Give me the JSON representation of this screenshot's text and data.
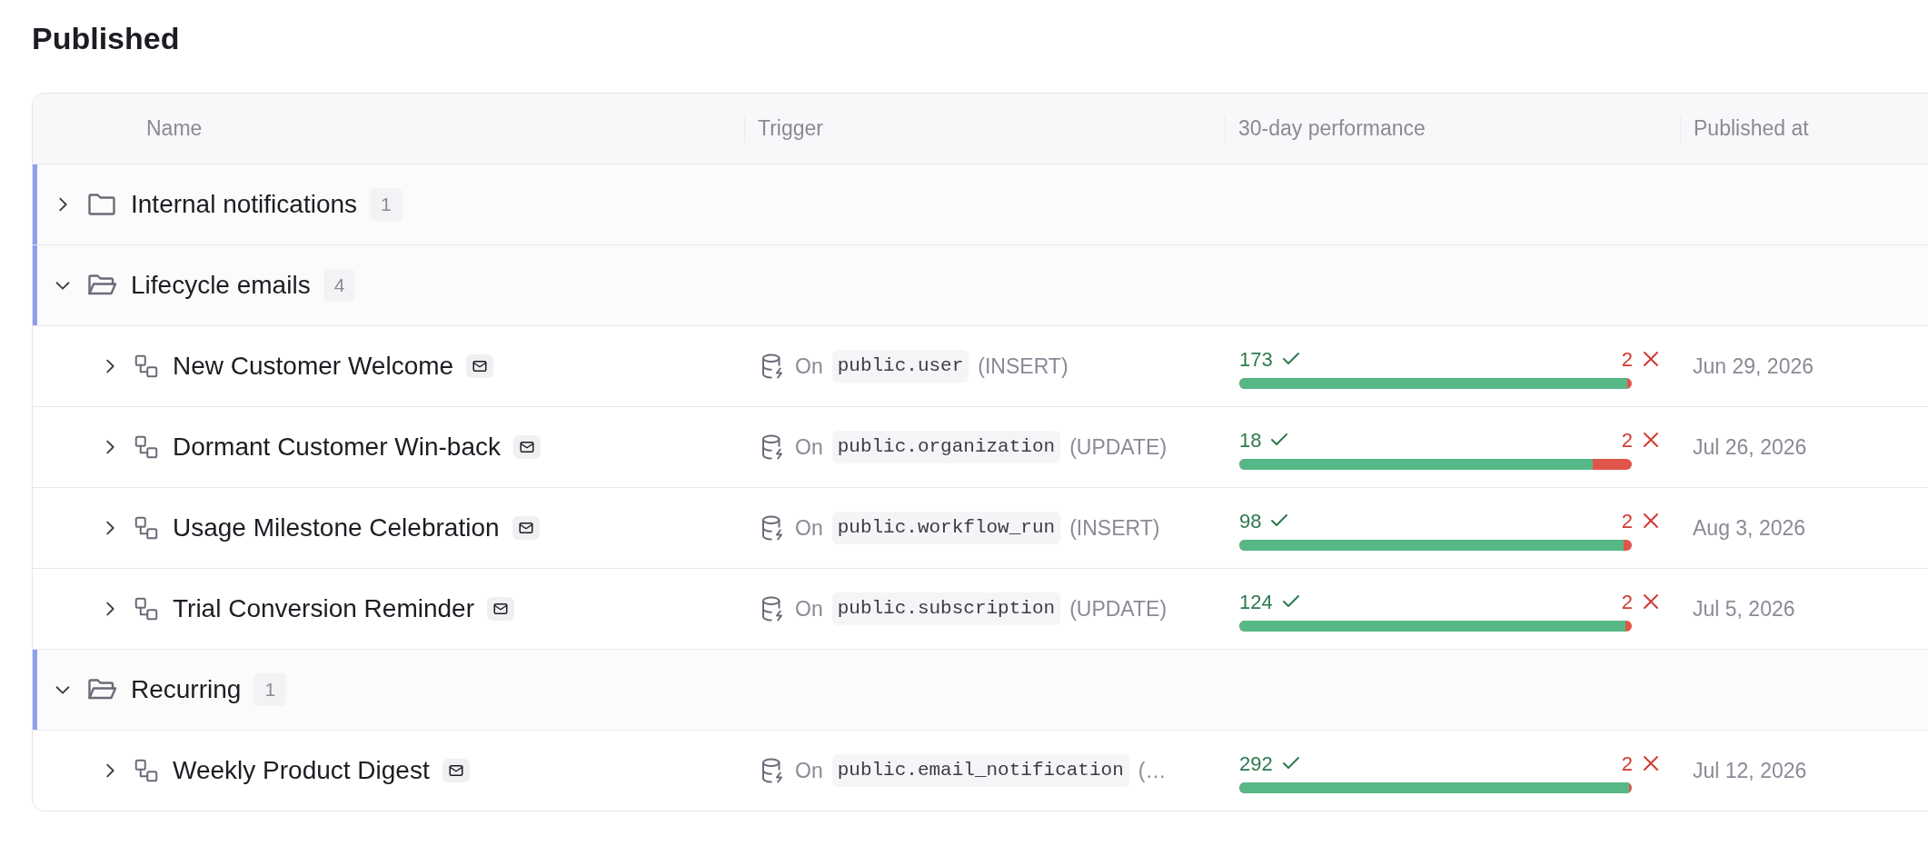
{
  "title": "Published",
  "table": {
    "columns": [
      "Name",
      "Trigger",
      "30-day performance",
      "Published at"
    ],
    "groups": [
      {
        "name": "Internal notifications",
        "count": "1",
        "expanded": false
      },
      {
        "name": "Lifecycle emails",
        "count": "4",
        "expanded": true,
        "items": [
          {
            "name": "New Customer Welcome",
            "expanded": false,
            "trigger_prefix": "On",
            "trigger_table": "public.user",
            "trigger_event": "(INSERT)",
            "success": "173",
            "failure": "2",
            "level": 0.989,
            "published_at": "Jun 29, 2026"
          },
          {
            "name": "Dormant Customer Win-back",
            "expanded": false,
            "trigger_prefix": "On",
            "trigger_table": "public.organization",
            "trigger_event": "(UPDATE)",
            "success": "18",
            "failure": "2",
            "level": 0.9,
            "published_at": "Jul 26, 2026"
          },
          {
            "name": "Usage Milestone Celebration",
            "expanded": false,
            "trigger_prefix": "On",
            "trigger_table": "public.workflow_run",
            "trigger_event": "(INSERT)",
            "success": "98",
            "failure": "2",
            "level": 0.98,
            "published_at": "Aug 3, 2026"
          },
          {
            "name": "Trial Conversion Reminder",
            "expanded": false,
            "trigger_prefix": "On",
            "trigger_table": "public.subscription",
            "trigger_event": "(UPDATE)",
            "success": "124",
            "failure": "2",
            "level": 0.984,
            "published_at": "Jul 5, 2026"
          }
        ]
      },
      {
        "name": "Recurring",
        "count": "1",
        "expanded": true,
        "items": [
          {
            "name": "Weekly Product Digest",
            "expanded": false,
            "trigger_prefix": "On",
            "trigger_table": "public.email_notification",
            "trigger_event": "(…",
            "success": "292",
            "failure": "2",
            "level": 0.993,
            "published_at": "Jul 12, 2026"
          }
        ]
      }
    ]
  }
}
